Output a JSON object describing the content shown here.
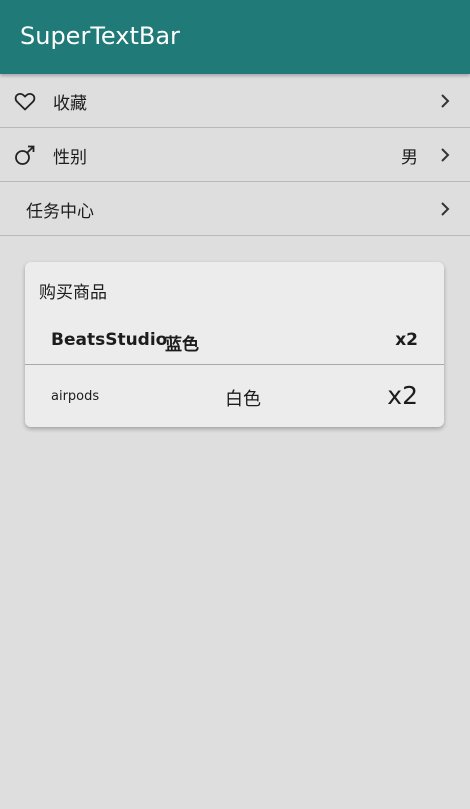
{
  "app": {
    "title": "SuperTextBar",
    "accent": "#1f7a78"
  },
  "rows": [
    {
      "label": "收藏",
      "icon": "heart-outline-icon",
      "value": ""
    },
    {
      "label": "性别",
      "icon": "male-symbol-icon",
      "value": "男"
    },
    {
      "label": "任务中心",
      "icon": "",
      "value": ""
    }
  ],
  "card": {
    "heading": "购买商品",
    "items": [
      {
        "name": "BeatsStudio",
        "color": "蓝色",
        "qty": "x2"
      },
      {
        "name": "airpods",
        "color": "白色",
        "qty": "x2"
      }
    ]
  }
}
